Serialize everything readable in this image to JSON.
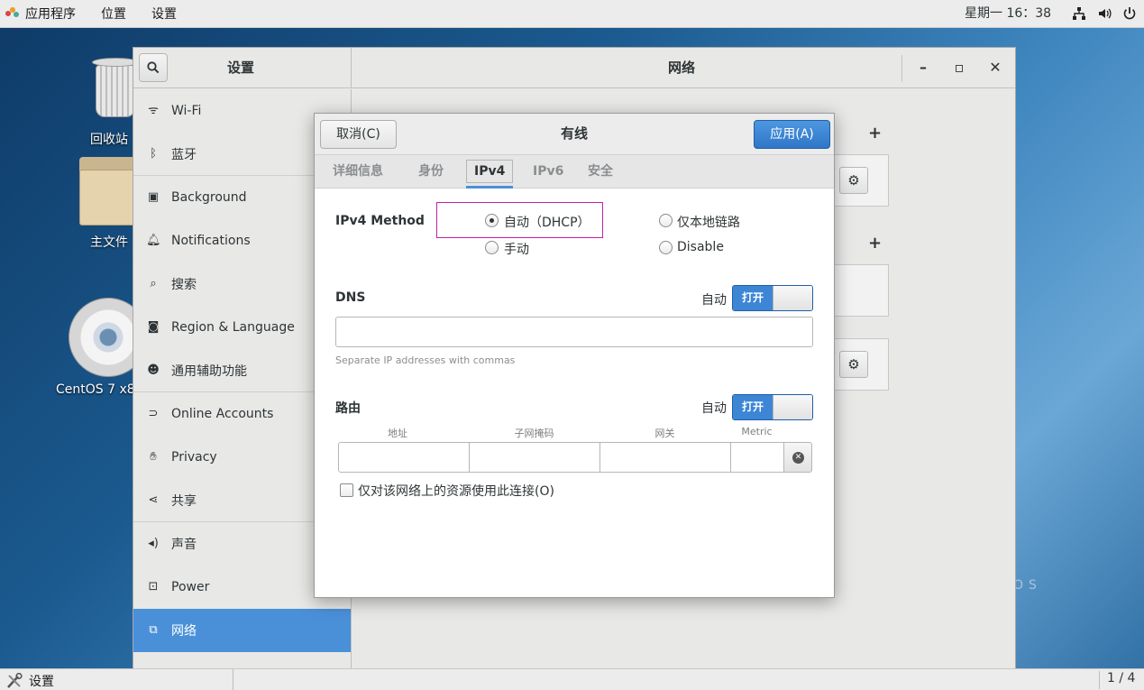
{
  "topbar": {
    "applications": "应用程序",
    "places": "位置",
    "settings": "设置",
    "clock": "星期一 16：38"
  },
  "desktop": {
    "trash_label": "回收站",
    "home_label": "主文件",
    "disc_label": "CentOS 7 x8"
  },
  "settings_window": {
    "sidebar_title": "设置",
    "main_title": "网络",
    "sidebar_items": [
      {
        "label": "Wi-Fi",
        "icon": "wifi-icon"
      },
      {
        "label": "蓝牙",
        "icon": "bluetooth-icon"
      },
      {
        "label": "Background",
        "icon": "background-icon"
      },
      {
        "label": "Notifications",
        "icon": "bell-icon"
      },
      {
        "label": "搜索",
        "icon": "search-icon"
      },
      {
        "label": "Region & Language",
        "icon": "camera-icon"
      },
      {
        "label": "通用辅助功能",
        "icon": "accessibility-icon"
      },
      {
        "label": "Online Accounts",
        "icon": "online-accounts-icon"
      },
      {
        "label": "Privacy",
        "icon": "hand-icon"
      },
      {
        "label": "共享",
        "icon": "share-icon"
      },
      {
        "label": "声音",
        "icon": "speaker-icon"
      },
      {
        "label": "Power",
        "icon": "power-plug-icon"
      },
      {
        "label": "网络",
        "icon": "network-icon"
      }
    ],
    "active_item": "网络"
  },
  "dialog": {
    "cancel_label": "取消(C)",
    "title": "有线",
    "apply_label": "应用(A)",
    "tabs": [
      "详细信息",
      "身份",
      "IPv4",
      "IPv6",
      "安全"
    ],
    "active_tab": "IPv4",
    "ipv4_method_label": "IPv4 Method",
    "methods": {
      "auto_dhcp": "自动（DHCP）",
      "link_local": "仅本地链路",
      "manual": "手动",
      "disable": "Disable"
    },
    "selected_method": "自动（DHCP）",
    "dns_label": "DNS",
    "dns_auto_label": "自动",
    "dns_switch_label": "打开",
    "dns_value": "",
    "dns_hint": "Separate IP addresses with commas",
    "routes_label": "路由",
    "routes_auto_label": "自动",
    "routes_switch_label": "打开",
    "route_columns": [
      "地址",
      "子网掩码",
      "网关",
      "Metric"
    ],
    "only_local_label": "仅对该网络上的资源使用此连接(O)",
    "only_local_checked": false
  },
  "taskbar": {
    "window_label": "设置",
    "pager": "1 / 4"
  },
  "colors": {
    "accent": "#4a90d9",
    "highlight_border": "#c020a8"
  }
}
